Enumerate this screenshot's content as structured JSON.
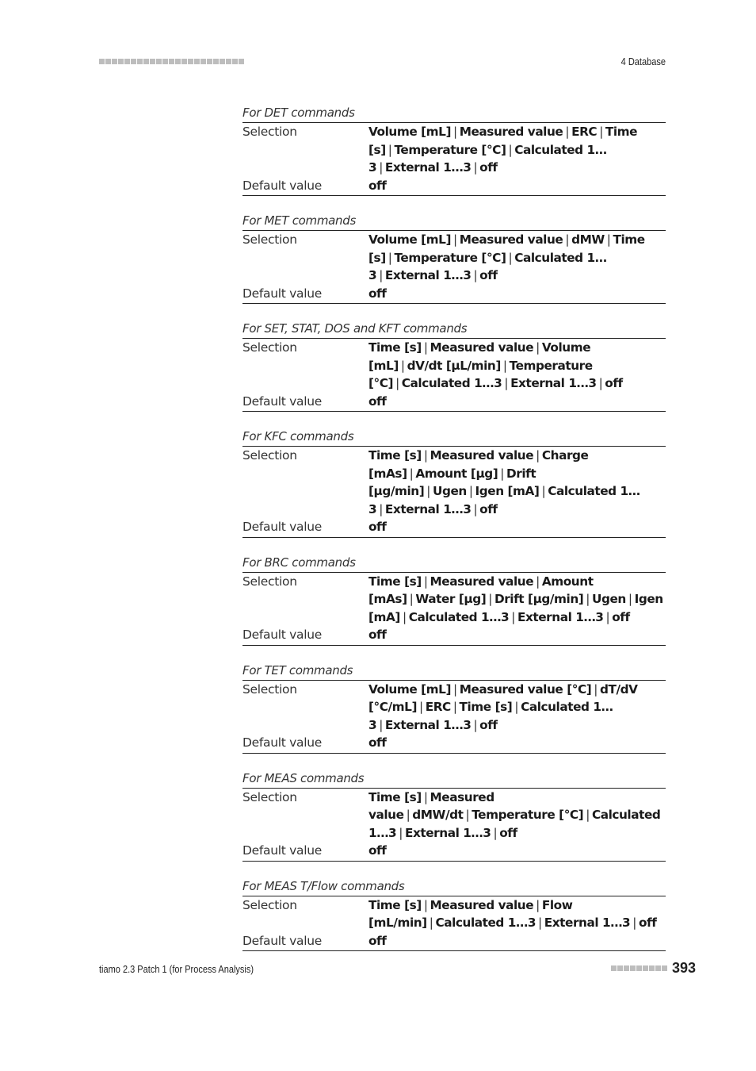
{
  "header": {
    "chapter": "4 Database",
    "decoration_squares": 23
  },
  "sections": [
    {
      "title": "For DET commands",
      "selection_label": "Selection",
      "selection_options": [
        "Volume [mL]",
        "Measured value",
        "ERC",
        "Time [s]",
        "Temperature [°C]",
        "Calculated 1…3",
        "External 1…3",
        "off"
      ],
      "default_label": "Default value",
      "default_value": "off"
    },
    {
      "title": "For MET commands",
      "selection_label": "Selection",
      "selection_options": [
        "Volume [mL]",
        "Measured value",
        "dMW",
        "Time [s]",
        "Temperature [°C]",
        "Calculated 1…3",
        "External 1…3",
        "off"
      ],
      "default_label": "Default value",
      "default_value": "off"
    },
    {
      "title": "For SET, STAT, DOS and KFT commands",
      "selection_label": "Selection",
      "selection_options": [
        "Time [s]",
        "Measured value",
        "Volume [mL]",
        "dV/dt [µL/min]",
        "Temperature [°C]",
        "Calculated 1…3",
        "External 1…3",
        "off"
      ],
      "default_label": "Default value",
      "default_value": "off"
    },
    {
      "title": "For KFC commands",
      "selection_label": "Selection",
      "selection_options": [
        "Time [s]",
        "Measured value",
        "Charge [mAs]",
        "Amount [µg]",
        "Drift [µg/min]",
        "Ugen",
        "Igen [mA]",
        "Calculated 1…3",
        "External 1…3",
        "off"
      ],
      "default_label": "Default value",
      "default_value": "off"
    },
    {
      "title": "For BRC commands",
      "selection_label": "Selection",
      "selection_options": [
        "Time [s]",
        "Measured value",
        "Amount [mAs]",
        "Water [µg]",
        "Drift [µg/min]",
        "Ugen",
        "Igen [mA]",
        "Calculated 1…3",
        "External 1…3",
        "off"
      ],
      "default_label": "Default value",
      "default_value": "off"
    },
    {
      "title": "For TET commands",
      "selection_label": "Selection",
      "selection_options": [
        "Volume [mL]",
        "Measured value [°C]",
        "dT/dV [°C/mL]",
        "ERC",
        "Time [s]",
        "Calculated 1…3",
        "External 1…3",
        "off"
      ],
      "default_label": "Default value",
      "default_value": "off"
    },
    {
      "title": "For MEAS commands",
      "selection_label": "Selection",
      "selection_options": [
        "Time [s]",
        "Measured value",
        "dMW/dt",
        "Temperature [°C]",
        "Calculated 1…3",
        "External 1…3",
        "off"
      ],
      "default_label": "Default value",
      "default_value": "off"
    },
    {
      "title": "For MEAS T/Flow commands",
      "selection_label": "Selection",
      "selection_options": [
        "Time [s]",
        "Measured value",
        "Flow [mL/min]",
        "Calculated 1…3",
        "External 1…3",
        "off"
      ],
      "default_label": "Default value",
      "default_value": "off"
    }
  ],
  "footer": {
    "document_title": "tiamo 2.3 Patch 1 (for Process Analysis)",
    "page_number": "393",
    "decoration_squares": 9
  }
}
